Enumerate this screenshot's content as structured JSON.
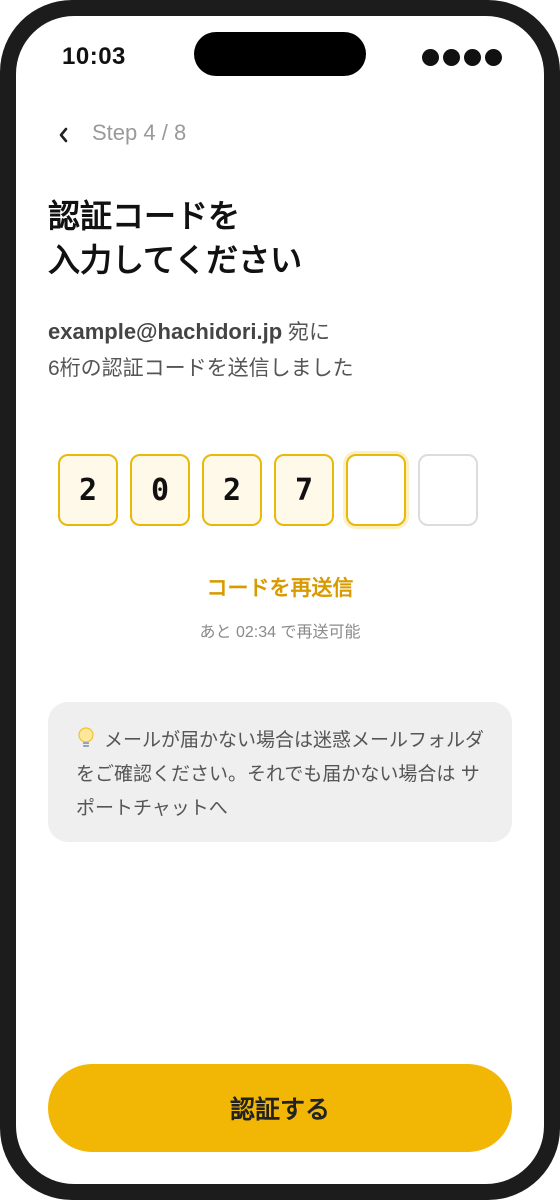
{
  "status_bar": {
    "time": "10:03"
  },
  "header": {
    "back_icon": "chevron-left-icon",
    "step_text": "Step 4 / 8"
  },
  "title": {
    "line1": "認証コードを",
    "line2": "入力してください"
  },
  "description": {
    "email": "example@hachidori.jp",
    "suffix": " 宛に",
    "line2": "6桁の認証コードを送信しました"
  },
  "otp": {
    "digits": [
      "2",
      "0",
      "2",
      "7",
      "",
      ""
    ]
  },
  "resend": {
    "label": "コードを再送信",
    "countdown": "あと 02:34 で再送可能"
  },
  "notice": {
    "icon": "lightbulb-icon",
    "text": "メールが届かない場合は迷惑メールフォルダをご確認ください。それでも届かない場合は サポートチャットへ"
  },
  "cta": {
    "label": "認証する"
  },
  "colors": {
    "accent": "#f2b705",
    "accent_text": "#d99a00",
    "otp_border": "#e8b90a",
    "otp_fill": "#fff9ea",
    "notice_bg": "#efefef"
  }
}
